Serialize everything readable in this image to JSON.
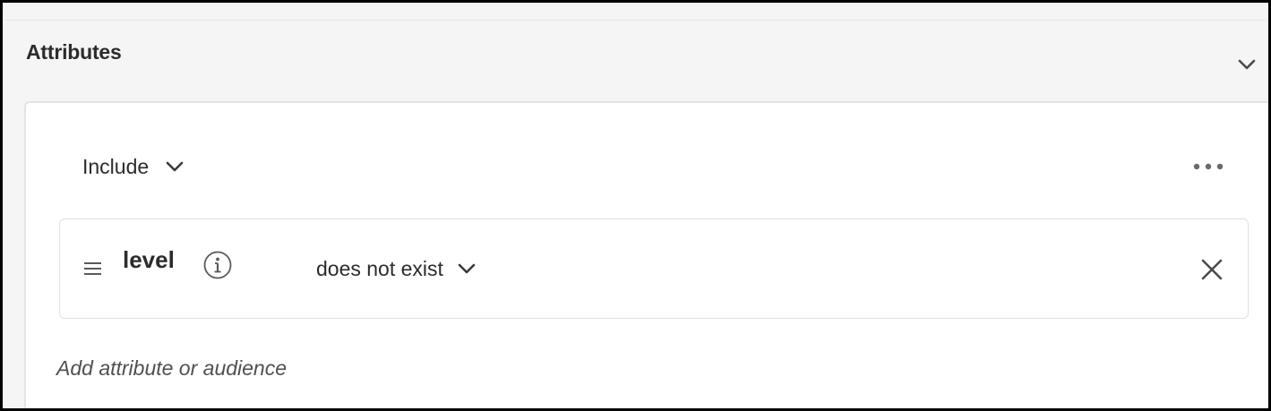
{
  "panel": {
    "title": "Attributes"
  },
  "rule": {
    "mode": "Include",
    "condition": {
      "attribute": "level",
      "operator": "does not exist"
    },
    "add_placeholder": "Add attribute or audience"
  },
  "icons": {
    "collapse": "chevron-down-icon",
    "mode_dropdown": "chevron-down-icon",
    "more": "more-horizontal-icon",
    "drag": "drag-handle-icon",
    "info": "info-icon",
    "operator_dropdown": "chevron-down-icon",
    "remove": "close-icon"
  },
  "colors": {
    "text": "#2c2c2c",
    "muted": "#505050",
    "icon": "#4b4b4b",
    "header_bg": "#f5f5f5",
    "card_border": "#e1e1e1"
  }
}
